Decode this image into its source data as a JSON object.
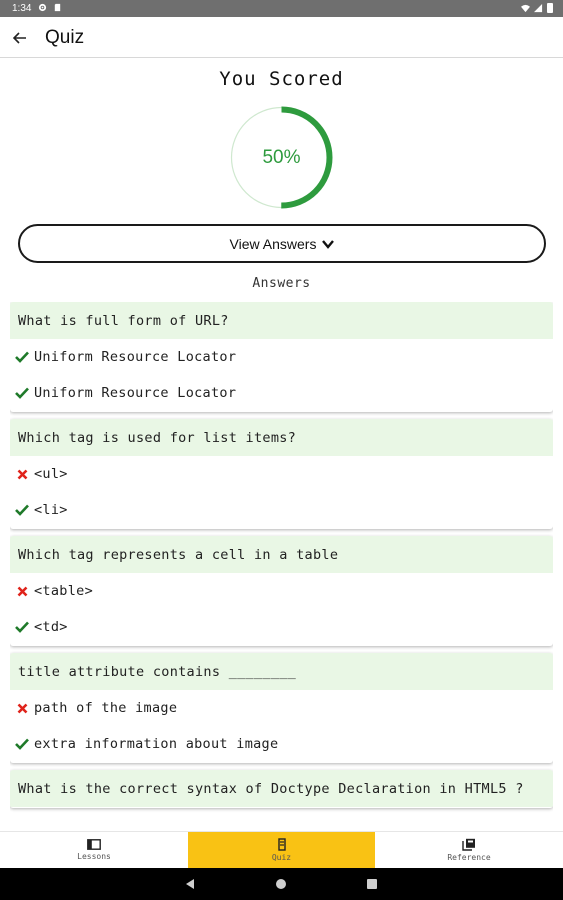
{
  "status_bar": {
    "time": "1:34"
  },
  "app_bar": {
    "title": "Quiz"
  },
  "score": {
    "heading": "You Scored",
    "percent_label": "50%",
    "percent_value": 50,
    "accent_color": "#2e9b3e"
  },
  "view_answers": {
    "label": "View Answers"
  },
  "answers_heading": "Answers",
  "questions": [
    {
      "question": "What is full form of URL?",
      "answers": [
        {
          "text": "Uniform Resource Locator",
          "correct": true
        },
        {
          "text": "Uniform Resource Locator",
          "correct": true
        }
      ]
    },
    {
      "question": "Which tag is used for list items?",
      "answers": [
        {
          "text": "<ul>",
          "correct": false
        },
        {
          "text": "<li>",
          "correct": true
        }
      ]
    },
    {
      "question": "Which tag represents a cell in a table",
      "answers": [
        {
          "text": "<table>",
          "correct": false
        },
        {
          "text": "<td>",
          "correct": true
        }
      ]
    },
    {
      "question": "title attribute contains ________",
      "answers": [
        {
          "text": "path of the image",
          "correct": false
        },
        {
          "text": "extra information about image",
          "correct": true
        }
      ]
    },
    {
      "question": "What is the correct syntax of Doctype Declaration in HTML5 ?",
      "answers": []
    }
  ],
  "bottom_nav": {
    "lessons": "Lessons",
    "quiz": "Quiz",
    "reference": "Reference",
    "active_color": "#f9c214"
  }
}
